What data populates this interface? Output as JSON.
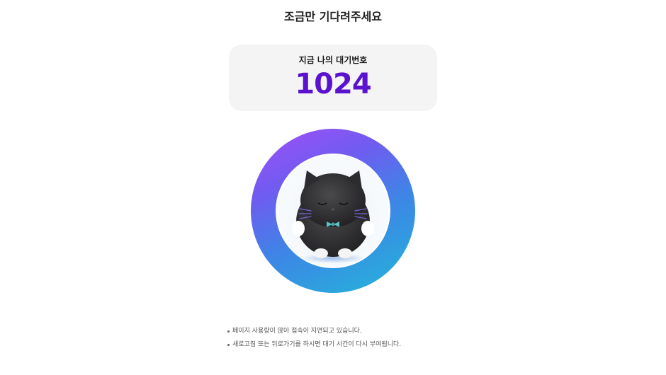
{
  "header": {
    "title": "조금만 기다려주세요"
  },
  "queue_card": {
    "label": "지금 나의 대기번호",
    "number": "1024",
    "number_color": "#5a12cf"
  },
  "progress_ring": {
    "gradient_colors": [
      "#a34ef7",
      "#6f5cf0",
      "#3d86e6",
      "#22b7d8"
    ],
    "mascot": "black-cat-plush-icon"
  },
  "notices": [
    "페이지 사용량이 많아 접속이 지연되고 있습니다.",
    "새로고침 또는 뒤로가기를 하시면 대기 시간이 다시 부여됩니다."
  ]
}
